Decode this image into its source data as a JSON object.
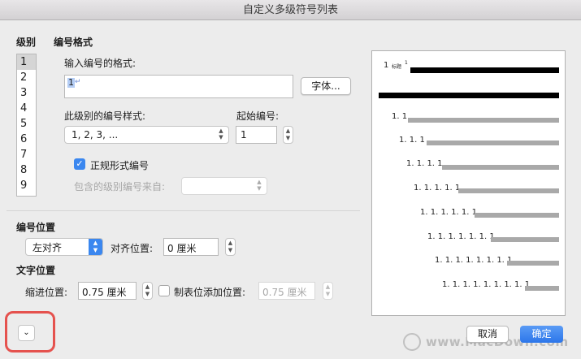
{
  "window": {
    "title": "自定义多级符号列表"
  },
  "level": {
    "heading": "级别",
    "items": [
      "1",
      "2",
      "3",
      "4",
      "5",
      "6",
      "7",
      "8",
      "9"
    ],
    "selected": "1"
  },
  "number_format": {
    "heading": "编号格式",
    "input_label": "输入编号的格式:",
    "input_value": "1",
    "font_button": "字体...",
    "style_label": "此级别的编号样式:",
    "style_value": "1, 2, 3, ...",
    "start_label": "起始编号:",
    "start_value": "1",
    "legal_checkbox_label": "正规形式编号",
    "legal_checked": true,
    "include_label": "包含的级别编号来自:",
    "include_value": ""
  },
  "number_position": {
    "heading": "编号位置",
    "alignment_value": "左对齐",
    "align_at_label": "对齐位置:",
    "align_at_value": "0 厘米"
  },
  "text_position": {
    "heading": "文字位置",
    "indent_label": "缩进位置:",
    "indent_value": "0.75 厘米",
    "tab_checkbox_label": "制表位添加位置:",
    "tab_checked": false,
    "tab_value": "0.75 厘米"
  },
  "preview": {
    "heading_label": "标题",
    "heading_superscript": "1",
    "lines": [
      {
        "label": "1",
        "style": "black"
      },
      {
        "label": "",
        "style": "black"
      },
      {
        "label": "1. 1",
        "style": "gray"
      },
      {
        "label": "1. 1. 1",
        "style": "gray"
      },
      {
        "label": "1. 1. 1. 1",
        "style": "gray"
      },
      {
        "label": "1. 1. 1. 1. 1",
        "style": "gray"
      },
      {
        "label": "1. 1. 1. 1. 1. 1",
        "style": "gray"
      },
      {
        "label": "1. 1. 1. 1. 1. 1. 1",
        "style": "gray"
      },
      {
        "label": "1. 1. 1. 1. 1. 1. 1. 1",
        "style": "gray"
      },
      {
        "label": "1. 1. 1. 1. 1. 1. 1. 1. 1",
        "style": "gray"
      }
    ]
  },
  "buttons": {
    "expand_icon": "chevron-down-icon",
    "cancel": "取消",
    "ok": "确定"
  },
  "watermark": {
    "text": "www.MacDown.com"
  },
  "colors": {
    "accent": "#3b87ef",
    "highlight": "#e5524e"
  }
}
